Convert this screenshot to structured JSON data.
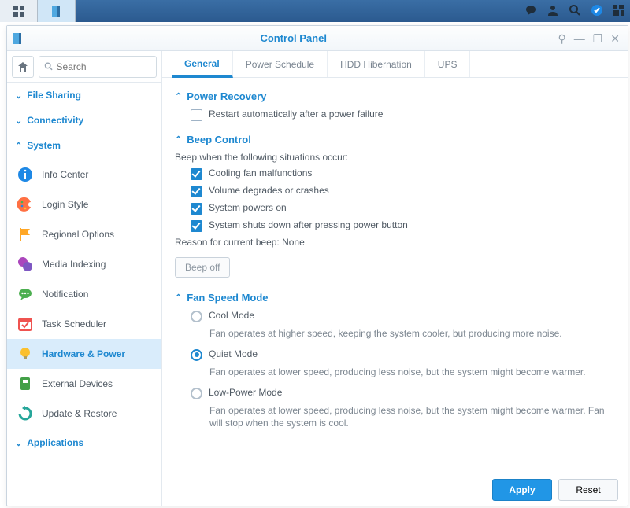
{
  "window": {
    "title": "Control Panel"
  },
  "search": {
    "placeholder": "Search"
  },
  "categories": {
    "file_sharing": "File Sharing",
    "connectivity": "Connectivity",
    "system": "System",
    "applications": "Applications"
  },
  "nav": {
    "info_center": "Info Center",
    "login_style": "Login Style",
    "regional": "Regional Options",
    "media_indexing": "Media Indexing",
    "notification": "Notification",
    "task_scheduler": "Task Scheduler",
    "hardware_power": "Hardware & Power",
    "external_devices": "External Devices",
    "update_restore": "Update & Restore"
  },
  "tabs": {
    "general": "General",
    "power_schedule": "Power Schedule",
    "hdd_hibernation": "HDD Hibernation",
    "ups": "UPS"
  },
  "sections": {
    "power_recovery": {
      "title": "Power Recovery",
      "restart_auto": "Restart automatically after a power failure"
    },
    "beep": {
      "title": "Beep Control",
      "intro": "Beep when the following situations occur:",
      "fan_malfunction": "Cooling fan malfunctions",
      "volume_degrades": "Volume degrades or crashes",
      "powers_on": "System powers on",
      "shutdown_button": "System shuts down after pressing power button",
      "reason_label": "Reason for current beep: None",
      "beep_off": "Beep off"
    },
    "fan": {
      "title": "Fan Speed Mode",
      "cool": "Cool Mode",
      "cool_desc": "Fan operates at higher speed, keeping the system cooler, but producing more noise.",
      "quiet": "Quiet Mode",
      "quiet_desc": "Fan operates at lower speed, producing less noise, but the system might become warmer.",
      "low": "Low-Power Mode",
      "low_desc": "Fan operates at lower speed, producing less noise, but the system might become warmer. Fan will stop when the system is cool."
    }
  },
  "buttons": {
    "apply": "Apply",
    "reset": "Reset"
  }
}
